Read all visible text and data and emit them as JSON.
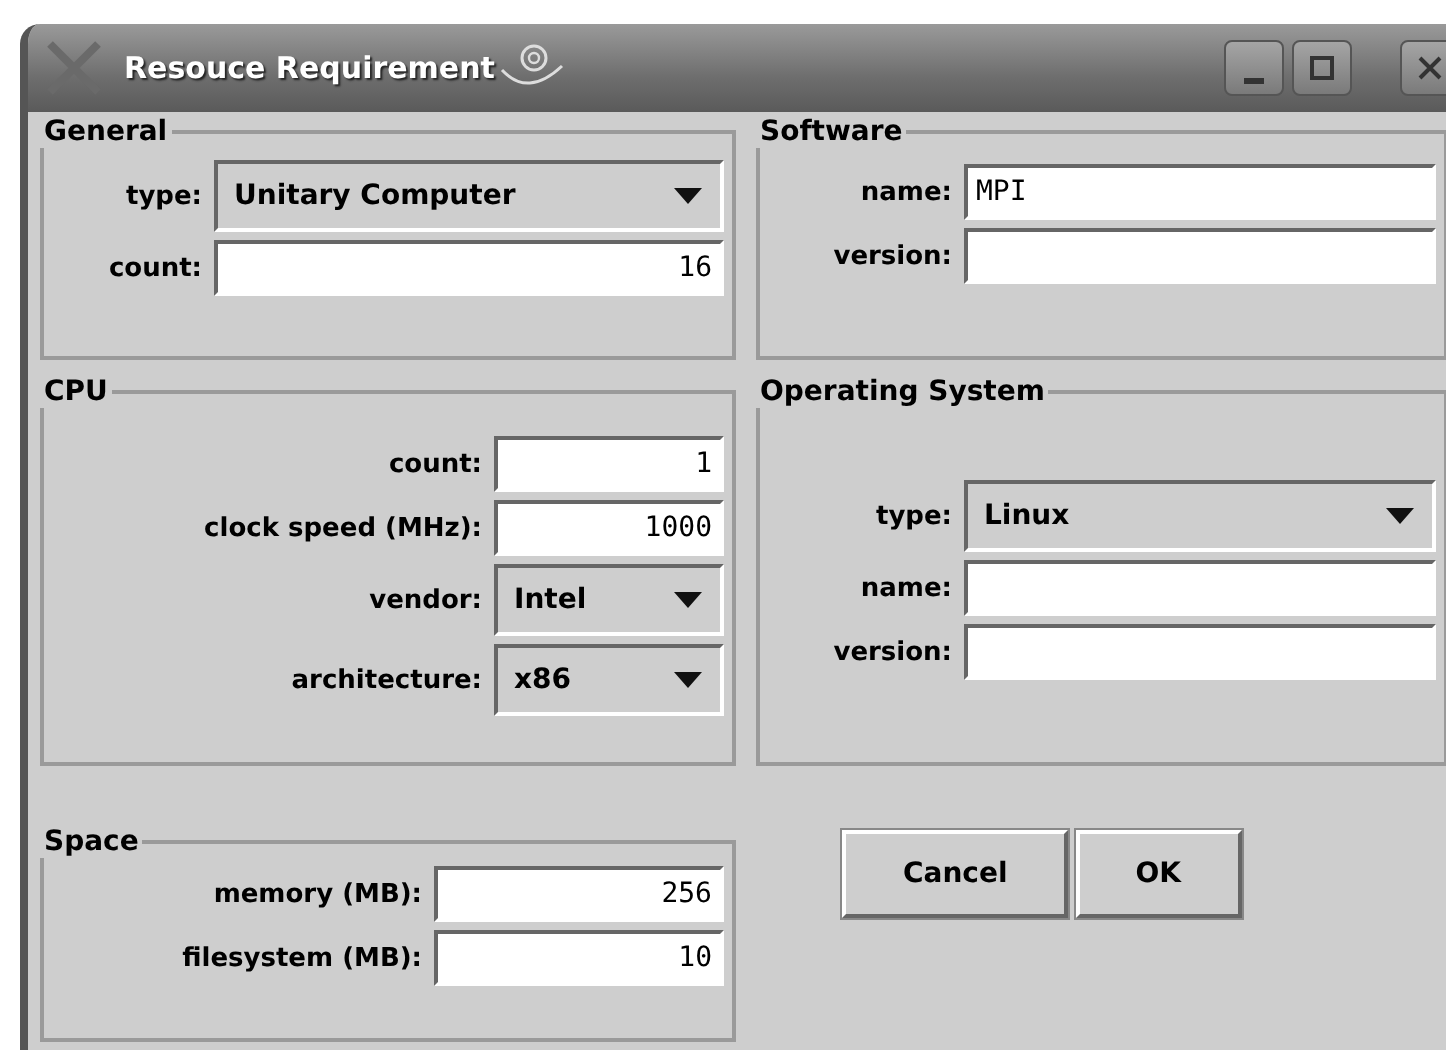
{
  "window": {
    "title": "Resouce Requirement"
  },
  "panels": [
    {
      "title": "General",
      "rows": [
        {
          "label": "type:",
          "kind": "combo",
          "value": "Unitary Computer"
        },
        {
          "label": "count:",
          "kind": "number",
          "value": "16"
        }
      ]
    },
    {
      "title": "Software",
      "rows": [
        {
          "label": "name:",
          "kind": "text",
          "value": "MPI"
        },
        {
          "label": "version:",
          "kind": "text"
        }
      ]
    },
    {
      "title": "CPU",
      "rows": [
        {
          "label": "count:",
          "kind": "number",
          "value": "1"
        },
        {
          "label": "clock speed (MHz):",
          "kind": "number",
          "value": "1000"
        },
        {
          "label": "vendor:",
          "kind": "combo",
          "value": "Intel"
        },
        {
          "label": "architecture:",
          "kind": "combo",
          "value": "x86"
        }
      ]
    },
    {
      "title": "Operating System",
      "rows": [
        {
          "label": "type:",
          "kind": "combo",
          "value": "Linux"
        },
        {
          "label": "name:",
          "kind": "text"
        },
        {
          "label": "version:",
          "kind": "text"
        }
      ]
    },
    {
      "title": "Space",
      "rows": [
        {
          "label": "memory (MB):",
          "kind": "number",
          "value": "256"
        },
        {
          "label": "filesystem (MB):",
          "kind": "number",
          "value": "10"
        }
      ]
    }
  ],
  "buttons": [
    {
      "label": "Cancel"
    },
    {
      "label": "OK"
    }
  ]
}
